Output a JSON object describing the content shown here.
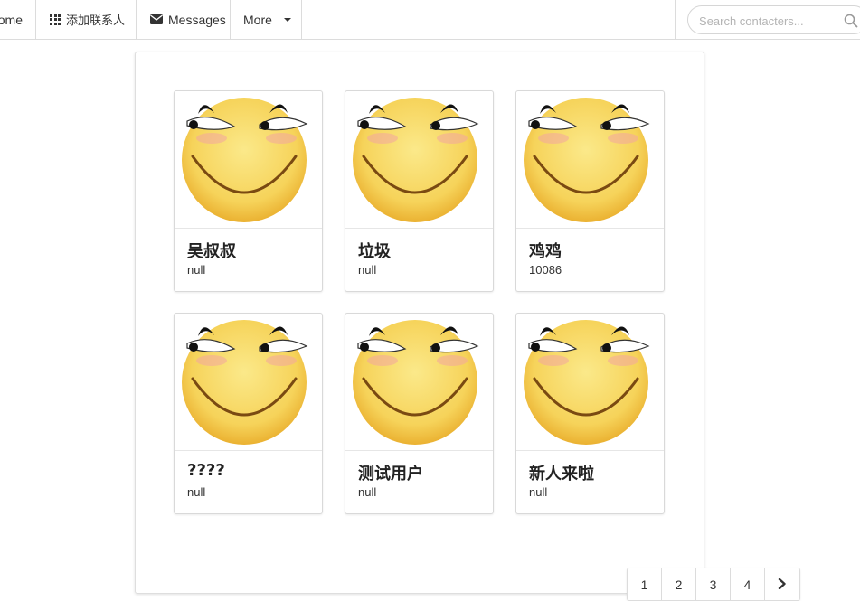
{
  "navbar": {
    "home_label": "Home",
    "add_contact_label": "添加联系人",
    "messages_label": "Messages",
    "more_label": "More",
    "search_placeholder": "Search contacters..."
  },
  "contacts": [
    {
      "name": "吴叔叔",
      "phone": "null"
    },
    {
      "name": "垃圾",
      "phone": "null"
    },
    {
      "name": "鸡鸡",
      "phone": "10086"
    },
    {
      "name": "????",
      "phone": "null"
    },
    {
      "name": "测试用户",
      "phone": "null"
    },
    {
      "name": "新人来啦",
      "phone": "null"
    }
  ],
  "pagination": {
    "pages": [
      "1",
      "2",
      "3",
      "4"
    ],
    "next_icon": "chevron-right-icon"
  },
  "colors": {
    "face": "#f5c842",
    "border": "#dcdcdc"
  }
}
